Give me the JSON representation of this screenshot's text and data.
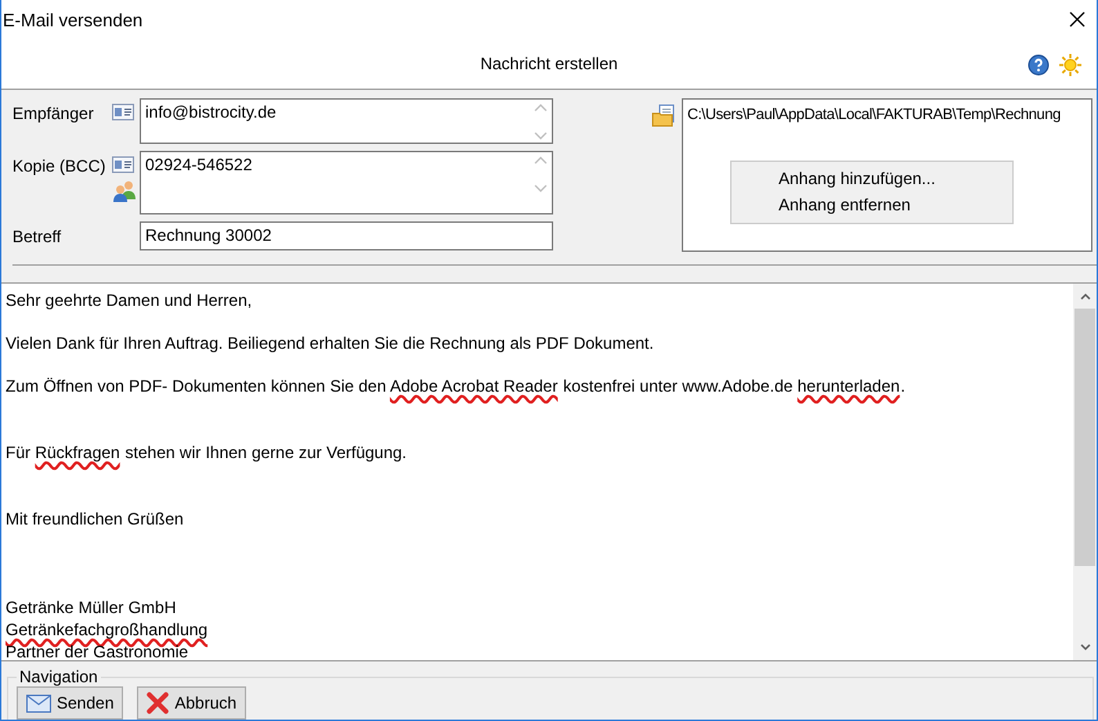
{
  "window": {
    "title": "E-Mail versenden"
  },
  "header": {
    "title": "Nachricht erstellen"
  },
  "form": {
    "fields": [
      {
        "label": "Empfänger",
        "value": "info@bistrocity.de",
        "kind": "multiline",
        "contact_icons": [
          {
            "kind": "card"
          }
        ]
      },
      {
        "label": "Kopie (BCC)",
        "value": "02924-546522",
        "kind": "multiline",
        "contact_icons": [
          {
            "kind": "card"
          },
          {
            "kind": "people"
          }
        ]
      },
      {
        "label": "Betreff",
        "value": "Rechnung 30002",
        "kind": "single"
      }
    ]
  },
  "attachments": {
    "items": [
      "C:\\Users\\Paul\\AppData\\Local\\FAKTURAB\\Temp\\Rechnung"
    ],
    "context_menu": [
      "Anhang hinzufügen...",
      "Anhang entfernen"
    ]
  },
  "body": {
    "lines": [
      {
        "kind": "line",
        "segments": [
          {
            "text": "Sehr geehrte Damen und Herren,",
            "misspelled": false
          }
        ]
      },
      {
        "kind": "para",
        "segments": [
          {
            "text": "Vielen Dank für Ihren Auftrag. Beiliegend erhalten Sie die Rechnung als PDF Dokument.",
            "misspelled": false
          }
        ]
      },
      {
        "kind": "para",
        "segments": [
          {
            "text": "Zum Öffnen von PDF- Dokumenten können Sie den ",
            "misspelled": false
          },
          {
            "text": "Adobe Acrobat Reader",
            "misspelled": true
          },
          {
            "text": " kostenfrei unter www.Adobe.de ",
            "misspelled": false
          },
          {
            "text": "herunterladen",
            "misspelled": true
          },
          {
            "text": ".",
            "misspelled": false
          }
        ]
      },
      {
        "kind": "section",
        "segments": [
          {
            "text": "Für ",
            "misspelled": false
          },
          {
            "text": "Rückfragen",
            "misspelled": true
          },
          {
            "text": " stehen wir Ihnen gerne zur Verfügung.",
            "misspelled": false
          }
        ]
      },
      {
        "kind": "section",
        "segments": [
          {
            "text": "Mit freundlichen Grüßen",
            "misspelled": false
          }
        ]
      },
      {
        "kind": "block",
        "segments": [
          {
            "text": "Getränke Müller GmbH",
            "misspelled": false
          }
        ]
      },
      {
        "kind": "line",
        "segments": [
          {
            "text": "Getränkefachgroßhandlung",
            "misspelled": true
          }
        ]
      },
      {
        "kind": "line",
        "segments": [
          {
            "text": "Partner der Gastronomie",
            "misspelled": false
          }
        ]
      }
    ]
  },
  "navigation": {
    "title": "Navigation",
    "buttons": [
      {
        "label": "Senden",
        "kind": "send"
      },
      {
        "label": "Abbruch",
        "kind": "cancel"
      }
    ]
  }
}
